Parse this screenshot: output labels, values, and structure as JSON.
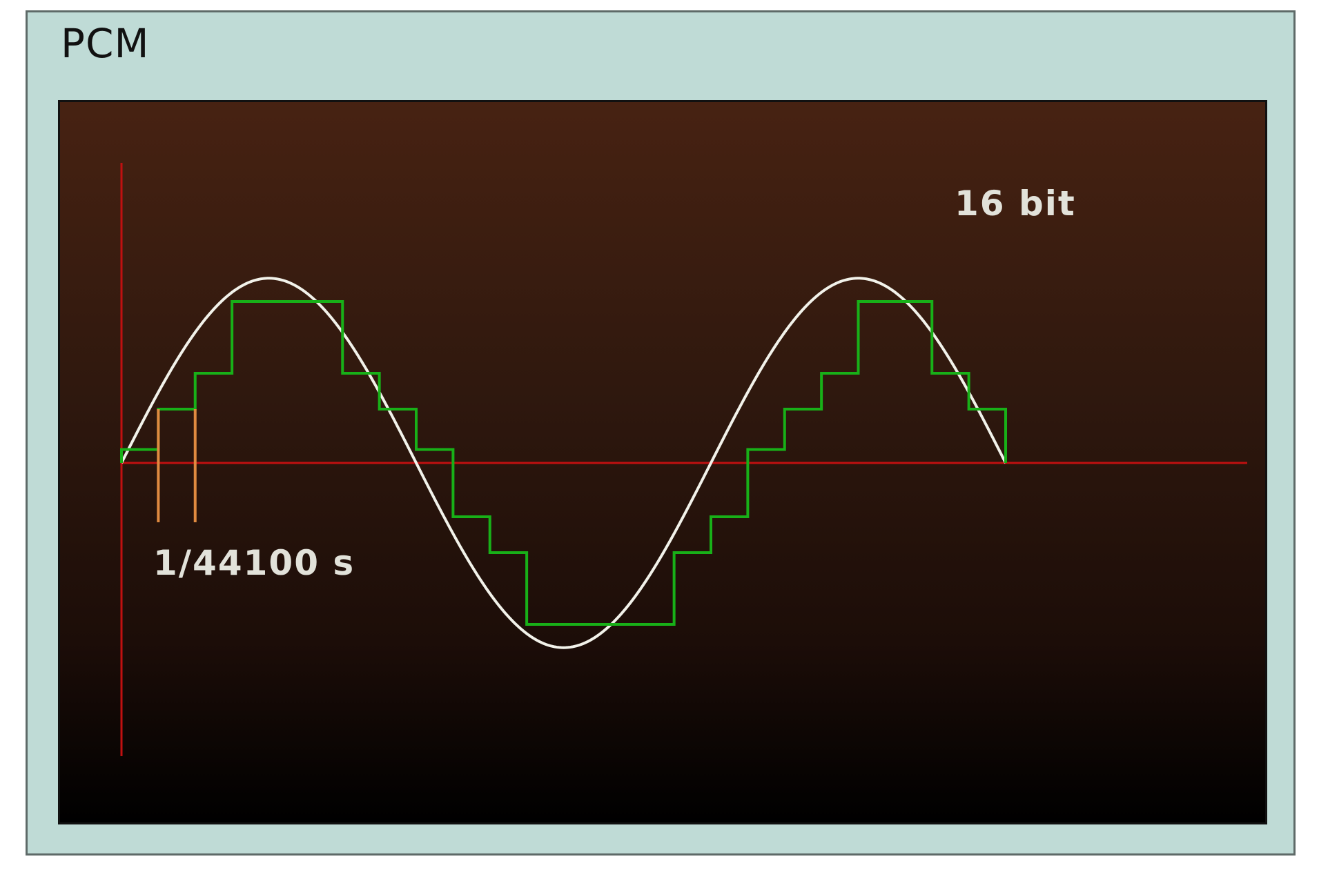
{
  "title": "PCM",
  "labels": {
    "sample_period": "1/44100 s",
    "bit_depth": "16 bit"
  },
  "colors": {
    "frame_background": "#bfdbd6",
    "frame_border": "#5e6a68",
    "panel_top": "#472212",
    "panel_bottom": "#000000",
    "axis": "#c01010",
    "analog_wave": "#f2f2ea",
    "sampled_wave": "#18b018",
    "sample_marker": "#e08a40",
    "label_text": "#e2e2da"
  },
  "chart_data": {
    "type": "line",
    "series": [
      {
        "kind": "analog-sine",
        "cycles": 1.5
      },
      {
        "kind": "quantized-staircase",
        "levels": [
          0.15,
          0.6,
          1.0,
          1.8,
          1.8,
          1.8,
          1.0,
          0.6,
          0.15,
          -0.6,
          -1.0,
          -1.8,
          -1.8,
          -1.8,
          -1.8,
          -1.0,
          -0.6,
          0.15,
          0.6,
          1.0,
          1.8,
          1.8,
          1.0,
          0.6,
          0.15,
          0
        ]
      }
    ]
  }
}
